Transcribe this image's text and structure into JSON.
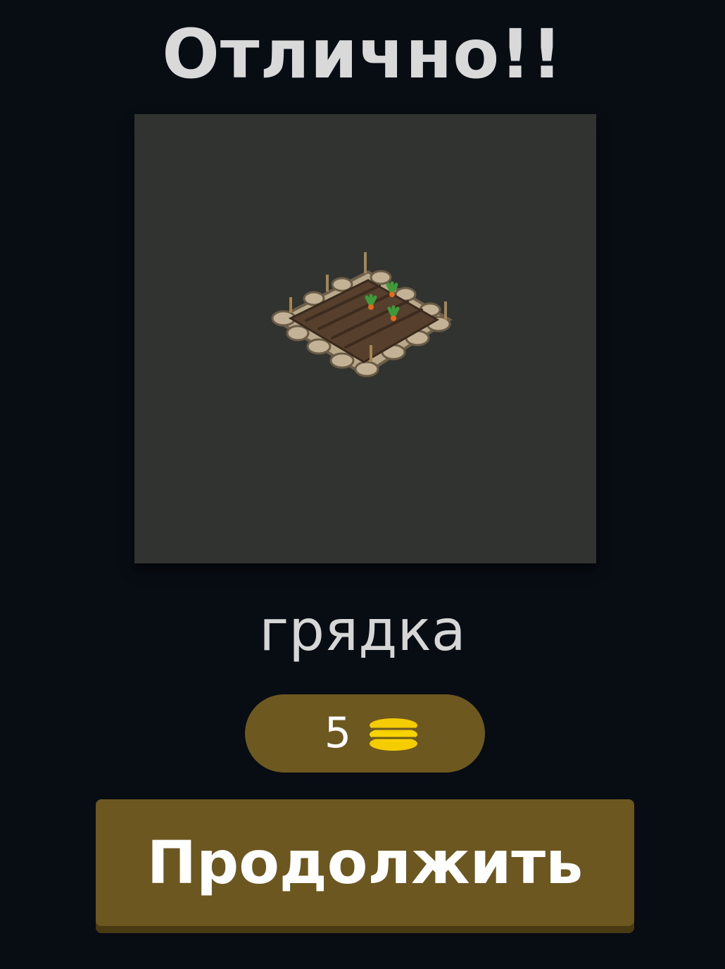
{
  "header": {
    "title": "Отлично!!"
  },
  "puzzle": {
    "image_icon": "garden-bed-icon",
    "answer_word": "грядка"
  },
  "reward": {
    "amount": "5",
    "icon": "coins-icon"
  },
  "actions": {
    "continue_label": "Продолжить"
  },
  "colors": {
    "background": "#080d14",
    "image_panel": "#313330",
    "reward_pill": "#6d5820",
    "button": "#6c5720",
    "coin": "#f4cc00",
    "title_text": "#d9d9d9"
  }
}
